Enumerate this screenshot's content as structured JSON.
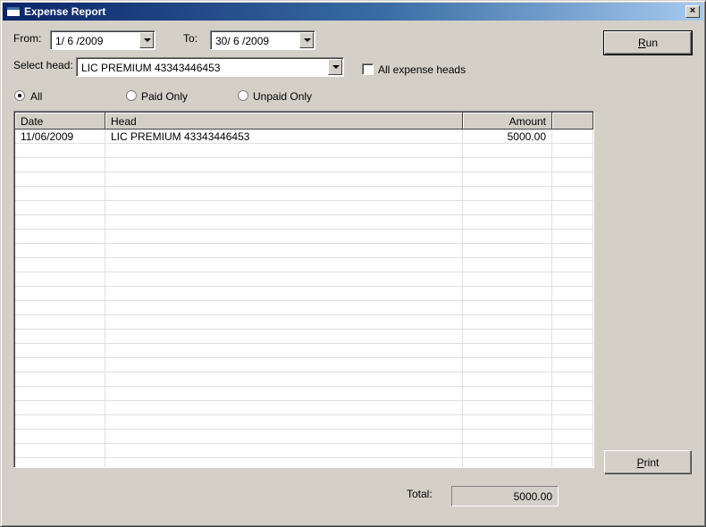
{
  "window": {
    "title": "Expense Report",
    "close_label": "×"
  },
  "filters": {
    "from_label": "From:",
    "from_value": "1/ 6 /2009",
    "to_label": "To:",
    "to_value": "30/ 6 /2009",
    "head_label": "Select head:",
    "head_value": "LIC PREMIUM 43343446453",
    "all_heads_label": "All expense heads",
    "all_heads_checked": false
  },
  "status_filter": {
    "selected": "All",
    "options": [
      "All",
      "Paid Only",
      "Unpaid Only"
    ]
  },
  "buttons": {
    "run_acc": "R",
    "run_rest": "un",
    "print_acc": "P",
    "print_rest": "rint"
  },
  "table": {
    "columns": [
      "Date",
      "Head",
      "Amount"
    ],
    "rows": [
      {
        "date": "11/06/2009",
        "head": "LIC PREMIUM 43343446453",
        "amount": "5000.00"
      }
    ]
  },
  "footer": {
    "total_label": "Total:",
    "total_value": "5000.00"
  }
}
